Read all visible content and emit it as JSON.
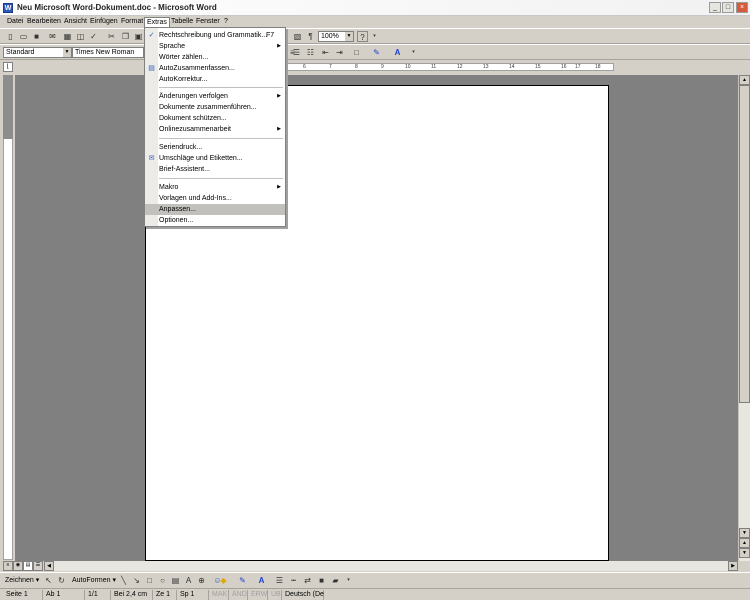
{
  "window": {
    "title": "Neu Microsoft Word-Dokument.doc - Microsoft Word",
    "app_icon": "W",
    "buttons": {
      "minimize": "_",
      "maximize": "□",
      "close": "×"
    }
  },
  "menubar": [
    "Datei",
    "Bearbeiten",
    "Ansicht",
    "Einfügen",
    "Format",
    "Extras",
    "Tabelle",
    "Fenster",
    "?"
  ],
  "formatting": {
    "style": "Standard",
    "font": "Times New Roman",
    "zoom": "100%",
    "paragraph_mark": "¶",
    "help": "?"
  },
  "ruler_numbers": [
    "1",
    "2",
    "3",
    "4",
    "5",
    "6",
    "7",
    "8",
    "9",
    "10",
    "11",
    "12",
    "13",
    "14",
    "15",
    "16",
    "17",
    "18"
  ],
  "extras_menu": {
    "items": [
      {
        "label": "Rechtschreibung und Grammatik...",
        "shortcut": "F7",
        "icon": "spellcheck-icon",
        "glyph": "✓"
      },
      {
        "label": "Sprache",
        "submenu": true
      },
      {
        "label": "Wörter zählen..."
      },
      {
        "label": "AutoZusammenfassen...",
        "icon": "autosummary-icon",
        "glyph": "▤"
      },
      {
        "label": "AutoKorrektur..."
      },
      {
        "label": "Änderungen verfolgen",
        "submenu": true
      },
      {
        "label": "Dokumente zusammenführen..."
      },
      {
        "label": "Dokument schützen..."
      },
      {
        "label": "Onlinezusammenarbeit",
        "submenu": true
      },
      {
        "label": "Seriendruck..."
      },
      {
        "label": "Umschläge und Etiketten...",
        "icon": "envelope-icon",
        "glyph": "✉"
      },
      {
        "label": "Brief-Assistent..."
      },
      {
        "label": "Makro",
        "submenu": true
      },
      {
        "label": "Vorlagen und Add-Ins..."
      },
      {
        "label": "Anpassen...",
        "highlighted": true
      },
      {
        "label": "Optionen..."
      }
    ]
  },
  "drawing_toolbar": {
    "draw_menu": "Zeichnen",
    "autoshapes": "AutoFormen"
  },
  "statusbar": {
    "page": "Seite 1",
    "section": "Ab 1",
    "pages": "1/1",
    "position": "Bei 2,4 cm",
    "line": "Ze 1",
    "column": "Sp 1",
    "mak": "MAK",
    "aend": "ÄND",
    "erw": "ERW",
    "ue": "ÜB",
    "language": "Deutsch (De"
  },
  "colors": {
    "accent_blue": "#2b5cb8",
    "workarea": "#808080",
    "chrome": "#d4d0c8"
  }
}
